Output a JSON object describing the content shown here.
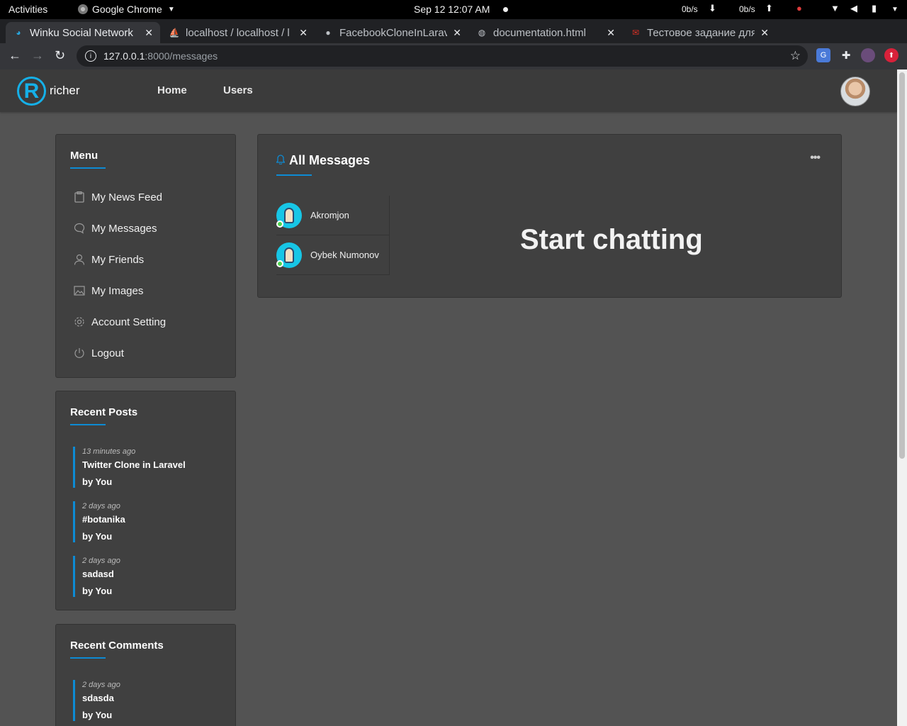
{
  "os": {
    "activities": "Activities",
    "app_name": "Google Chrome",
    "clock": "Sep 12  12:07 AM",
    "net_down": "0b/s",
    "net_up": "0b/s"
  },
  "browser": {
    "tabs": [
      {
        "title": "Winku Social Network"
      },
      {
        "title": "localhost / localhost / l"
      },
      {
        "title": "FacebookCloneInLarav"
      },
      {
        "title": "documentation.html"
      },
      {
        "title": "Тестовое задание для"
      }
    ],
    "url_host": "127.0.0.1",
    "url_path": ":8000/messages"
  },
  "site": {
    "logo_text": "richer",
    "nav": {
      "home": "Home",
      "users": "Users"
    }
  },
  "menu": {
    "title": "Menu",
    "items": [
      {
        "label": "My News Feed"
      },
      {
        "label": "My Messages"
      },
      {
        "label": "My Friends"
      },
      {
        "label": "My Images"
      },
      {
        "label": "Account Setting"
      },
      {
        "label": "Logout"
      }
    ]
  },
  "recent_posts": {
    "title": "Recent Posts",
    "items": [
      {
        "time": "13 minutes ago",
        "title": "Twitter Clone in Laravel",
        "by": "by You"
      },
      {
        "time": "2 days ago",
        "title": "#botanika",
        "by": "by You"
      },
      {
        "time": "2 days ago",
        "title": "sadasd",
        "by": "by You"
      }
    ]
  },
  "recent_comments": {
    "title": "Recent Comments",
    "items": [
      {
        "time": "2 days ago",
        "title": "sdasda",
        "by": "by You"
      }
    ]
  },
  "messages": {
    "title": "All Messages",
    "more": "•••",
    "contacts": [
      {
        "name": "Akromjon"
      },
      {
        "name": "Oybek Numonov"
      }
    ],
    "placeholder": "Start chatting"
  },
  "colors": {
    "accent": "#0d8bd4",
    "logo": "#15b0e8",
    "online": "#4cd34c"
  }
}
